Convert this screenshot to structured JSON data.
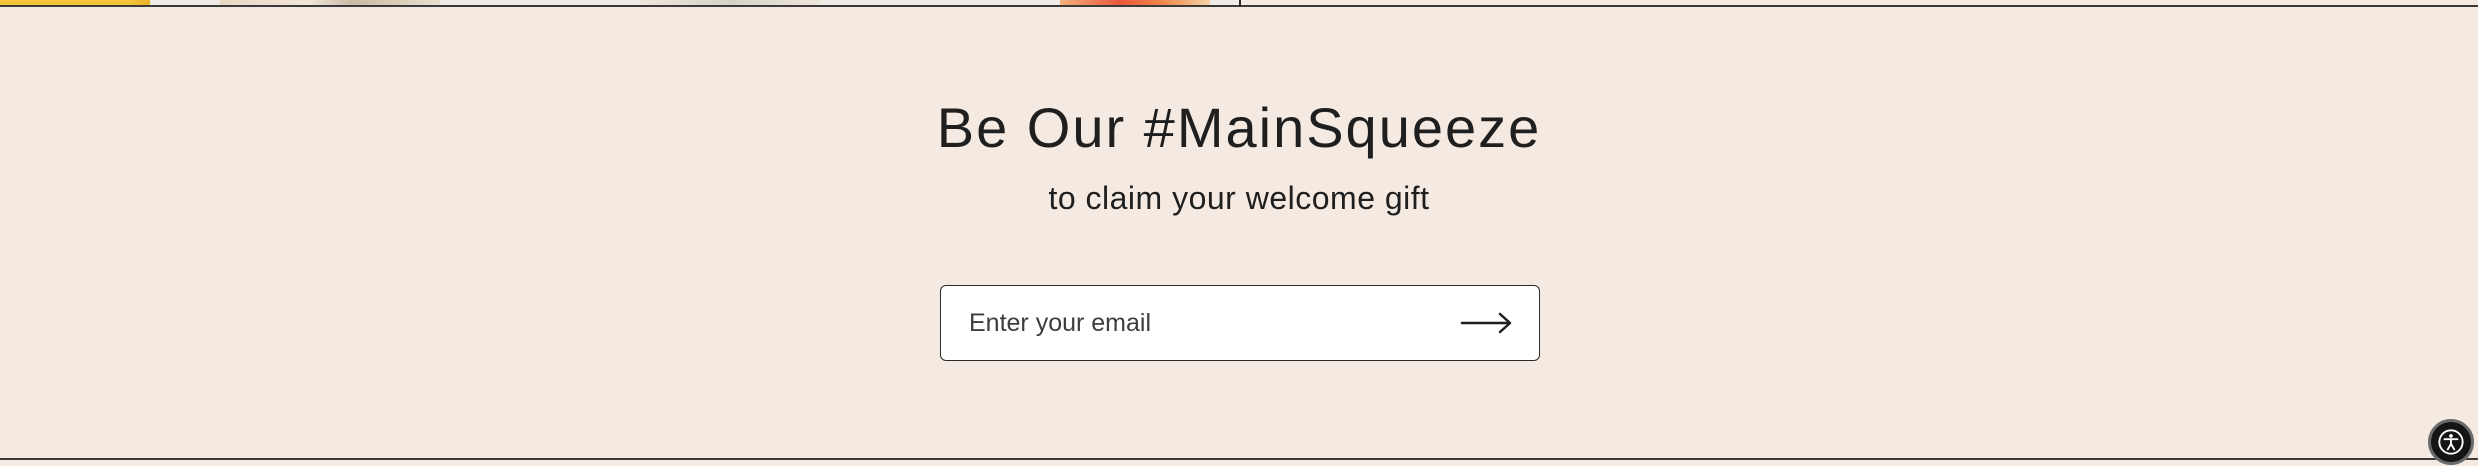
{
  "newsletter": {
    "headline": "Be Our #MainSqueeze",
    "subheadline": "to claim your welcome gift",
    "email_placeholder": "Enter your email",
    "submit_icon": "arrow-right-icon"
  },
  "widgets": {
    "accessibility_icon": "accessibility-icon"
  },
  "colors": {
    "background": "#f4eae1",
    "text": "#1f1f1f",
    "input_border": "#2b2b2b",
    "accessibility_button": "#141414"
  }
}
